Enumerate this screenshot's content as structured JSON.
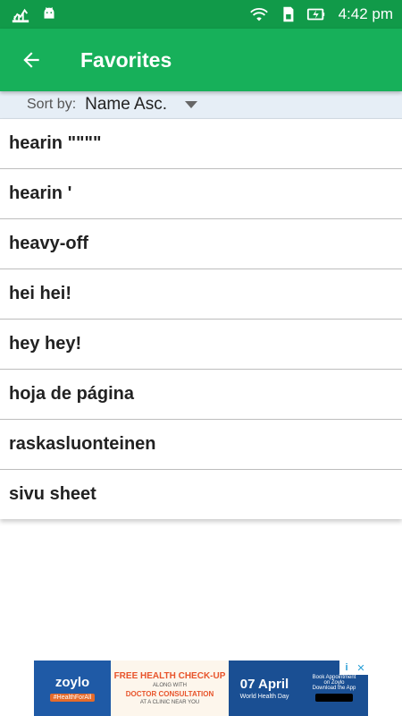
{
  "status_bar": {
    "time": "4:42 pm",
    "icons": [
      "stats-icon",
      "android-debug-icon",
      "wifi-icon",
      "sd-card-icon",
      "battery-charging-icon"
    ]
  },
  "app_bar": {
    "title": "Favorites",
    "back_icon": "arrow-back-icon"
  },
  "sort": {
    "label": "Sort by:",
    "value": "Name Asc."
  },
  "favorites": [
    "hearin \"\"\"\"",
    "hearin '",
    "heavy-off",
    "hei hei!",
    "hey hey!",
    "hoja de página",
    "raskasluonteinen",
    "sivu sheet"
  ],
  "ad": {
    "brand": "zoylo",
    "hashtag": "#HealthForAll",
    "headline": "FREE HEALTH CHECK-UP",
    "line1": "ALONG WITH",
    "line2": "DOCTOR CONSULTATION",
    "line3": "AT A CLINIC NEAR YOU",
    "date": "07 April",
    "event": "World Health Day",
    "cta1": "Book Appointment",
    "cta2": "on Zoylo",
    "cta3": "Download the App"
  },
  "colors": {
    "status_bar": "#119a49",
    "app_bar": "#17b05a",
    "sort_bar": "#e6eef6"
  }
}
